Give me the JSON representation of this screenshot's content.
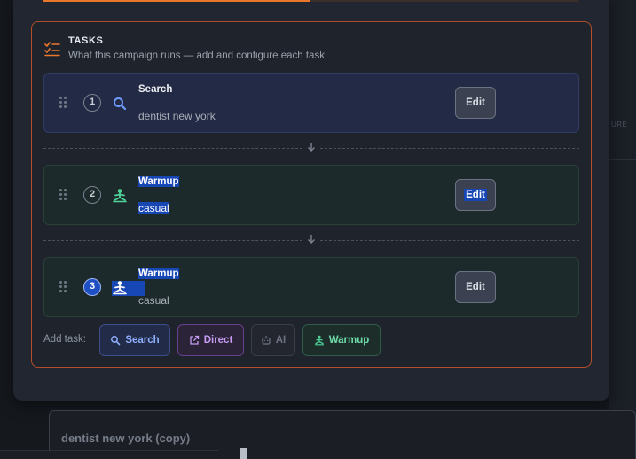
{
  "section": {
    "title": "TASKS",
    "subtitle": "What this campaign runs — add and configure each task",
    "progress_fraction": 0.5
  },
  "tasks": [
    {
      "number": "1",
      "type": "Search",
      "icon": "search-icon",
      "query": "dentist new york",
      "edit_label": "Edit"
    },
    {
      "number": "2",
      "type": "Warmup",
      "icon": "warmup-icon",
      "query": "casual",
      "edit_label": "Edit"
    },
    {
      "number": "3",
      "type": "Warmup",
      "icon": "warmup-icon",
      "query": "casual",
      "edit_label": "Edit"
    }
  ],
  "add_task": {
    "label": "Add task:",
    "buttons": [
      {
        "label": "Search",
        "icon": "search-icon"
      },
      {
        "label": "Direct",
        "icon": "external-link-icon"
      },
      {
        "label": "AI",
        "icon": "robot-icon"
      },
      {
        "label": "Warmup",
        "icon": "warmup-icon"
      }
    ]
  },
  "background": {
    "campaign_name_value": "dentist new york (copy)",
    "right_ghost_text": "URE"
  },
  "colors": {
    "accent_orange": "#e8772e",
    "search_blue": "#8fb0ff",
    "warmup_green": "#6fdcaa",
    "direct_purple": "#c89cf2",
    "selection": "#1746b5"
  }
}
